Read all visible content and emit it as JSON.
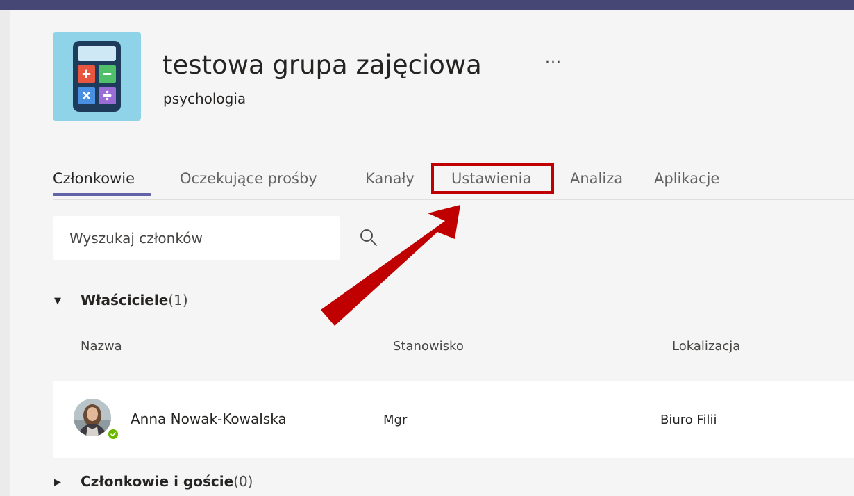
{
  "team": {
    "name": "testowa grupa zajęciowa",
    "more": "···",
    "subtitle": "psychologia"
  },
  "tabs": [
    {
      "label": "Członkowie",
      "active": true
    },
    {
      "label": "Oczekujące prośby"
    },
    {
      "label": "Kanały"
    },
    {
      "label": "Ustawienia",
      "highlighted": true
    },
    {
      "label": "Analiza"
    },
    {
      "label": "Aplikacje"
    }
  ],
  "search": {
    "placeholder": "Wyszukaj członków"
  },
  "owners": {
    "title": "Właściciele",
    "count": "(1)",
    "expanded": true
  },
  "columns": {
    "name": "Nazwa",
    "title": "Stanowisko",
    "location": "Lokalizacja"
  },
  "members_rows": [
    {
      "name": "Anna Nowak-Kowalska",
      "title": "Mgr",
      "location": "Biuro Filii",
      "presence": "available"
    }
  ],
  "members_guests": {
    "title": "Członkowie i goście",
    "count": "(0)",
    "expanded": false
  },
  "colors": {
    "topbar": "#464775",
    "accent": "#6264a7",
    "highlight": "#c00000",
    "arrow": "#c00000",
    "presence": "#6bb700"
  },
  "icons": {
    "team": "calculator-icon",
    "search": "search-icon",
    "expand": "caret-down-icon",
    "collapse": "caret-right-icon"
  }
}
